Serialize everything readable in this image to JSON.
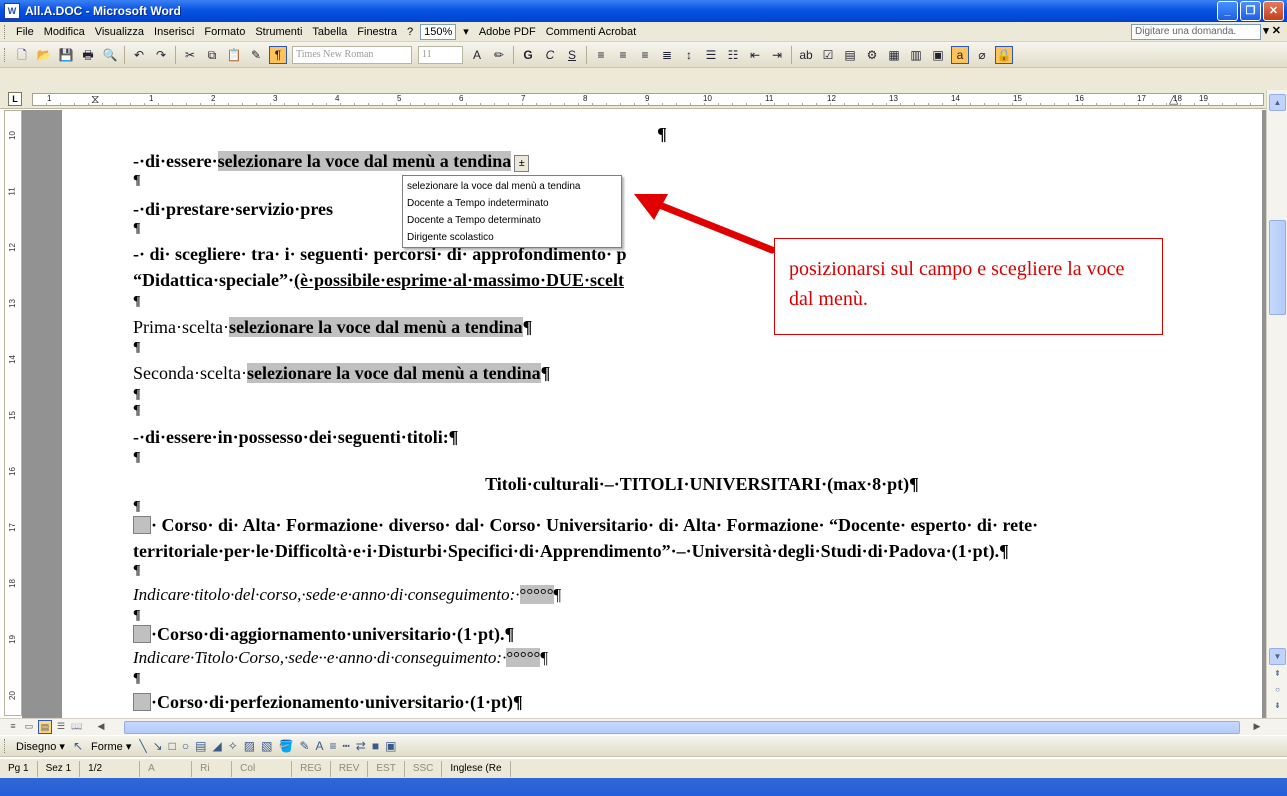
{
  "window": {
    "title": "All.A.DOC - Microsoft Word",
    "icon_label": "W"
  },
  "menu": {
    "items": [
      "File",
      "Modifica",
      "Visualizza",
      "Inserisci",
      "Formato",
      "Strumenti",
      "Tabella",
      "Finestra",
      "?"
    ],
    "zoom": "150%",
    "extras": [
      "Adobe PDF",
      "Commenti Acrobat"
    ],
    "question_placeholder": "Digitare una domanda."
  },
  "toolbar": {
    "font_name": "Times New Roman",
    "font_size": "11"
  },
  "ruler_numbers": [
    "1",
    "1",
    "2",
    "3",
    "4",
    "5",
    "6",
    "7",
    "8",
    "9",
    "10",
    "11",
    "12",
    "13",
    "14",
    "15",
    "16",
    "17",
    "18",
    "19"
  ],
  "vruler_numbers": [
    "10",
    "11",
    "12",
    "13",
    "14",
    "15",
    "16",
    "17",
    "18",
    "19",
    "20"
  ],
  "document": {
    "top_pilcrow": "¶",
    "line1_prefix": "-·di·essere·",
    "field1": "selezionare la voce dal menù a tendina",
    "dd_arrow": "±",
    "p": "¶",
    "line2": "-·di·prestare·servizio·pres",
    "line3a": "-· di· scegliere· tra· i· seguenti· percorsi· di· approfondimento· p",
    "line3b_a": "“Didattica·speciale”·",
    "line3b_b": "(è·possibile·esprime·al·massimo·DUE·scelt",
    "prima_label": "Prima·scelta·",
    "prima_field": "selezionare la voce dal menù a tendina",
    "seconda_label": "Seconda·scelta·",
    "seconda_field": "selezionare la voce dal menù a tendina",
    "titoli_line": "-·di·essere·in·possesso·dei·seguenti·titoli:¶",
    "heading": "Titoli·culturali·–·TITOLI·UNIVERSITARI·(max·8·pt)¶",
    "corso1_a": "· Corso· di· Alta· Formazione· diverso· dal· Corso· Universitario· di· Alta· Formazione· “Docente· esperto· di· rete·",
    "corso1_b": "territoriale·per·le·Difficoltà·e·i·Disturbi·Specifici·di·Apprendimento”·–·Università·degli·Studi·di·Padova·(1·pt).¶",
    "indicare1": "Indicare·titolo·del·corso,·sede·e·anno·di·conseguimento:·",
    "field_dots": "°°°°°",
    "corso2": "·Corso·di·aggiornamento·universitario·(1·pt).¶",
    "indicare2": "Indicare·Titolo·Corso,·sede··e·anno·di·conseguimento:·",
    "corso3": "·Corso·di·perfezionamento·universitario·(1·pt)¶"
  },
  "dropdown": {
    "options": [
      "selezionare la voce dal menù a tendina",
      "Docente a Tempo indeterminato",
      "Docente a Tempo determinato",
      "Dirigente scolastico"
    ]
  },
  "callout": {
    "text": "posizionarsi sul campo e scegliere la voce dal menù.",
    "color": "#d90000"
  },
  "drawbar": {
    "draw_label": "Disegno ▾",
    "shapes_label": "Forme ▾"
  },
  "status": {
    "page": "Pg 1",
    "section": "Sez 1",
    "pages": "1/2",
    "at": "A",
    "line": "Ri",
    "col": "Col",
    "modes": [
      "REG",
      "REV",
      "EST",
      "SSC"
    ],
    "language": "Inglese (Re"
  }
}
